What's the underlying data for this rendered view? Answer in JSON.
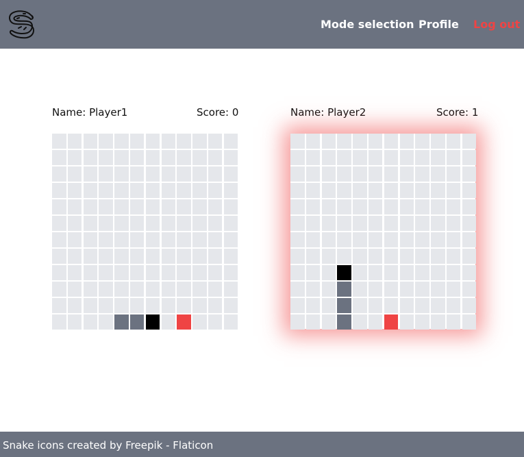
{
  "nav": {
    "logo_icon": "snake-icon",
    "links": [
      {
        "label": "Mode selection"
      },
      {
        "label": "Profile"
      },
      {
        "label": "Log out",
        "color": "#ef4444"
      }
    ]
  },
  "players": [
    {
      "name_label": "Name: Player1",
      "score_label": "Score: 0",
      "grid_size": [
        12,
        12
      ],
      "head": [
        11,
        6
      ],
      "body": [
        [
          11,
          4
        ],
        [
          11,
          5
        ]
      ],
      "food": [
        11,
        8
      ],
      "highlighted": false
    },
    {
      "name_label": "Name: Player2",
      "score_label": "Score: 1",
      "grid_size": [
        12,
        12
      ],
      "head": [
        8,
        3
      ],
      "body": [
        [
          9,
          3
        ],
        [
          10,
          3
        ],
        [
          11,
          3
        ]
      ],
      "food": [
        11,
        6
      ],
      "highlighted": true
    }
  ],
  "footer": {
    "credit": "Snake icons created by Freepik - Flaticon"
  },
  "colors": {
    "navbar": "#6b7280",
    "cell": "#e5e7eb",
    "snake_body": "#6b7280",
    "snake_head": "#000000",
    "food": "#ef4444",
    "logout": "#ef4444"
  }
}
